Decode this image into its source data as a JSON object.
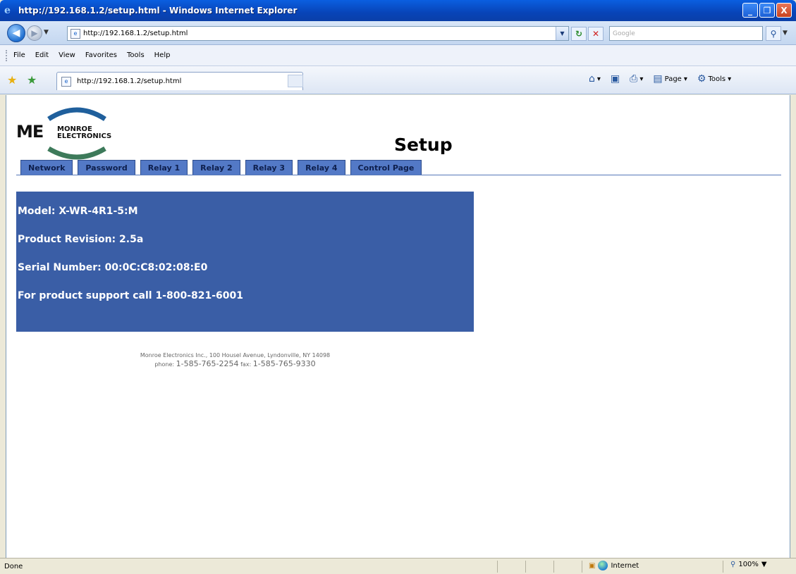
{
  "window": {
    "title": "http://192.168.1.2/setup.html - Windows Internet Explorer",
    "controls": {
      "minimize": "_",
      "maximize": "❐",
      "close": "X"
    }
  },
  "address_bar": {
    "url": "http://192.168.1.2/setup.html",
    "search_placeholder": "Google"
  },
  "menu": [
    "File",
    "Edit",
    "View",
    "Favorites",
    "Tools",
    "Help"
  ],
  "tab": {
    "label": "http://192.168.1.2/setup.html"
  },
  "command_bar": {
    "page_label": "Page",
    "tools_label": "Tools"
  },
  "page": {
    "logo": {
      "mark": "ME",
      "line1": "MONROE",
      "line2": "ELECTRONICS"
    },
    "title": "Setup",
    "nav_tabs": [
      "Network",
      "Password",
      "Relay 1",
      "Relay 2",
      "Relay 3",
      "Relay 4",
      "Control Page"
    ],
    "info": {
      "model": "Model: X-WR-4R1-5:M",
      "revision": "Product Revision: 2.5a",
      "serial": "Serial Number: 00:0C:C8:02:08:E0",
      "support": "For product support call 1-800-821-6001"
    },
    "footer": {
      "address": "Monroe Electronics Inc., 100 Housel Avenue, Lyndonville, NY 14098",
      "phone_label": "phone:",
      "phone": "1-585-765-2254",
      "fax_label": "fax:",
      "fax": "1-585-765-9330"
    }
  },
  "status_bar": {
    "status": "Done",
    "zone": "Internet",
    "zoom": "100%"
  },
  "colors": {
    "tab_blue": "#5379c6",
    "info_blue": "#3a5ea6"
  }
}
